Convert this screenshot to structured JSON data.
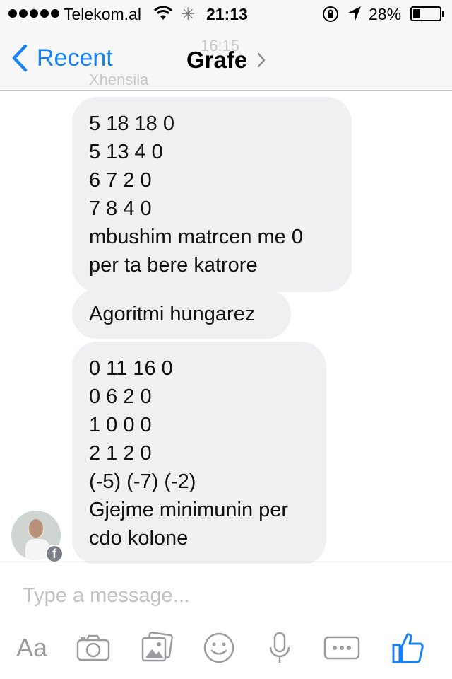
{
  "status_bar": {
    "carrier": "Telekom.al",
    "time": "21:13",
    "battery_percent": "28%",
    "battery_level": 0.28
  },
  "nav": {
    "back_label": "Recent",
    "title": "Grafe",
    "ghost_time": "16:15",
    "ghost_name": "Xhensila"
  },
  "messages": [
    {
      "text": "5 18 18 0\n5 13 4 0\n6 7 2 0\n7 8 4 0\n mbushim matrcen me 0\nper ta bere katrore"
    },
    {
      "text": "Agoritmi hungarez"
    },
    {
      "text": "0 11 16 0\n0 6 2 0\n1 0 0 0\n2 1 2 0\n(-5) (-7) (-2)\nGjejme minimunin per\ncdo kolone"
    }
  ],
  "composer": {
    "placeholder": "Type a message...",
    "text_tool_label": "Aa"
  },
  "icons": [
    "camera-icon",
    "photo-gallery-icon",
    "sticker-icon",
    "microphone-icon",
    "more-icon",
    "like-icon"
  ],
  "colors": {
    "accent": "#1a82f7",
    "bubble": "#f0eff1",
    "icon_gray": "#9b9ba0"
  }
}
